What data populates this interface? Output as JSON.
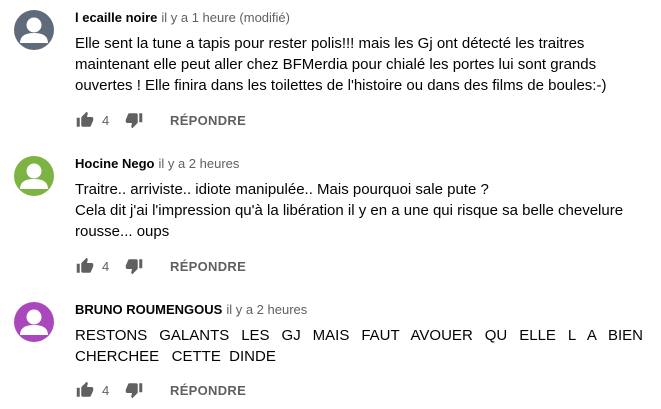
{
  "comments": [
    {
      "author": "l ecaille noire",
      "time": "il y a 1 heure (modifié)",
      "avatar_color": "#5f6b7a",
      "lines": [
        "Elle sent la tune a tapis pour rester polis!!! mais les Gj ont détecté les traitres",
        "maintenant elle peut aller chez BFMerdia pour chialé  les portes lui sont grands",
        "ouvertes ! Elle finira dans les toilettes de l'histoire ou dans des films de boules:-)"
      ],
      "likes": "4",
      "reply_label": "RÉPONDRE"
    },
    {
      "author": "Hocine Nego",
      "time": "il y a 2 heures",
      "avatar_color": "#7cb342",
      "lines": [
        "Traitre.. arriviste.. idiote manipulée.. Mais pourquoi sale pute ?",
        "Cela dit j'ai l'impression qu'à la libération il y en a une qui risque sa belle chevelure",
        "rousse... oups"
      ],
      "likes": "4",
      "reply_label": "RÉPONDRE"
    },
    {
      "author": "BRUNO ROUMENGOUS",
      "time": "il y a 2 heures",
      "avatar_color": "#ab47bc",
      "lines": [
        "RESTONS GALANTS LES GJ MAIS FAUT AVOUER QU ELLE L A BIEN",
        "CHERCHEE   CETTE  DINDE"
      ],
      "likes": "4",
      "reply_label": "RÉPONDRE"
    }
  ]
}
